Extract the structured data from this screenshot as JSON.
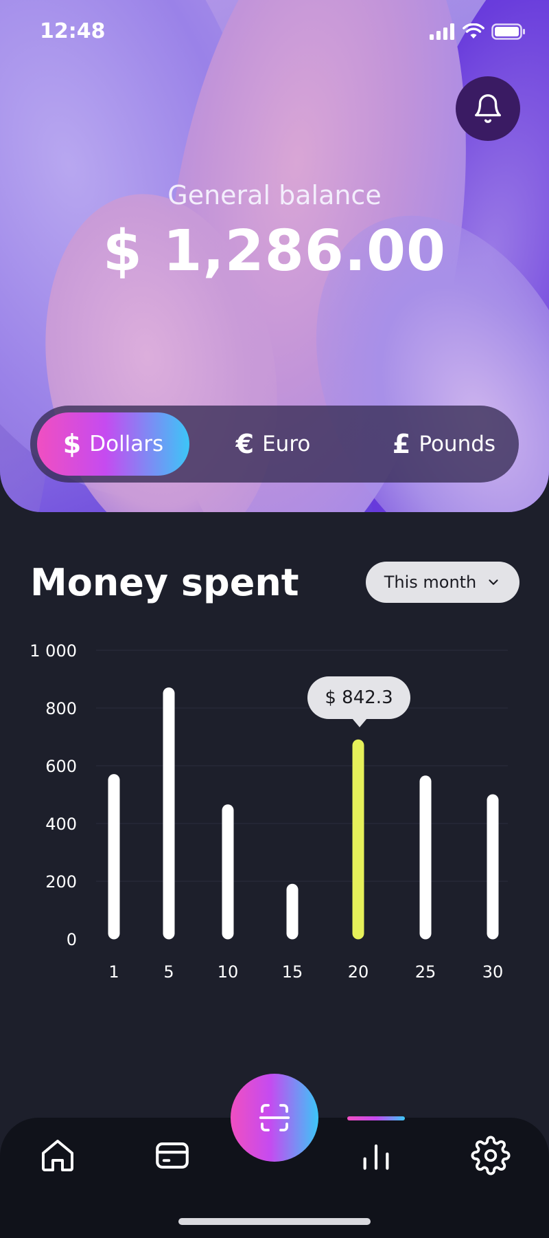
{
  "status_bar": {
    "time": "12:48"
  },
  "header": {
    "balance_label": "General balance",
    "balance_value": "$ 1,286.00"
  },
  "currency_switch": {
    "selected": "Dollars",
    "tabs": [
      {
        "symbol": "$",
        "label": "Dollars"
      },
      {
        "symbol": "€",
        "label": "Euro"
      },
      {
        "symbol": "£",
        "label": "Pounds"
      }
    ]
  },
  "section": {
    "title": "Money spent",
    "period_label": "This month"
  },
  "chart_data": {
    "type": "bar",
    "categories": [
      "1",
      "5",
      "10",
      "15",
      "20",
      "25",
      "30"
    ],
    "values": [
      570,
      870,
      465,
      190,
      690,
      565,
      500
    ],
    "highlighted_index": 4,
    "highlight_color": "#e6f05a",
    "bar_color": "#ffffff",
    "tooltip": "$ 842.3",
    "y_ticks": [
      "0",
      "200",
      "400",
      "600",
      "800",
      "1 000"
    ],
    "ylim": [
      0,
      1000
    ],
    "grid": true
  },
  "bottom_nav": {
    "items": [
      "home-icon",
      "card-icon",
      "scan-icon",
      "stats-icon",
      "gear-icon"
    ],
    "active": "stats-icon"
  },
  "colors": {
    "background": "#1d1f2b",
    "accent_gradient": [
      "#f04fc1",
      "#c54bf0",
      "#3cc6f7"
    ],
    "highlight": "#e6f05a"
  }
}
